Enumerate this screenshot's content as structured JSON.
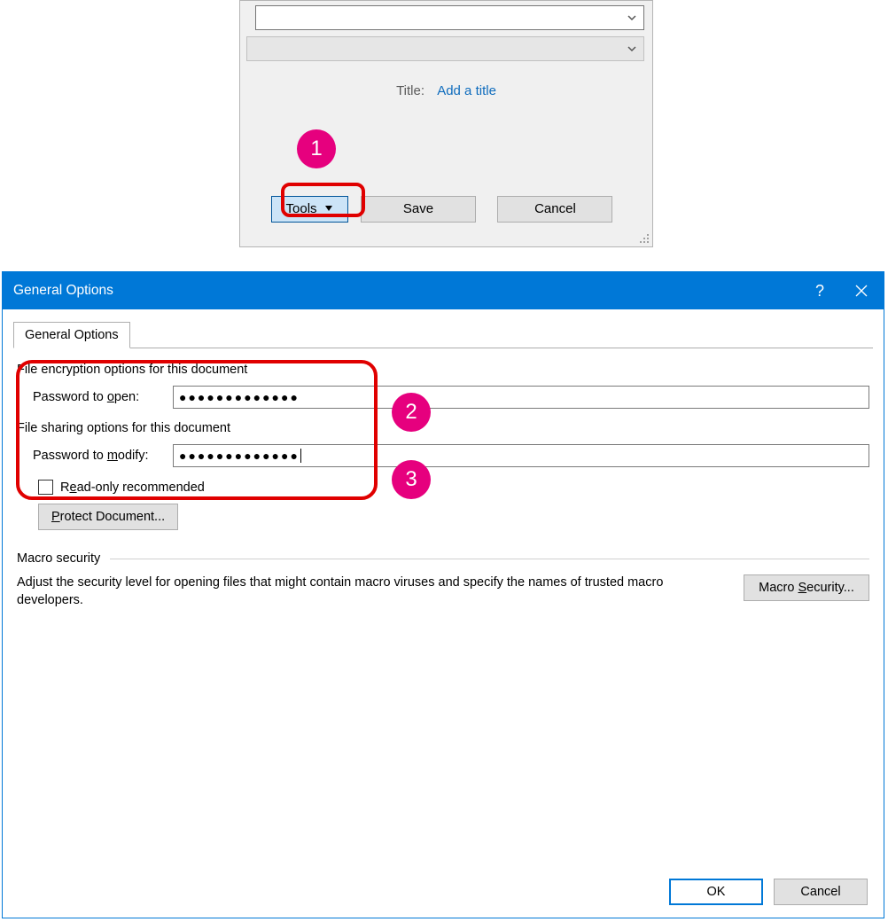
{
  "save_dialog": {
    "filename_value": "",
    "filetype_value": "",
    "title_label": "Title:",
    "title_placeholder": "Add a title",
    "tools_label": "Tools",
    "save_label": "Save",
    "cancel_label": "Cancel"
  },
  "general_options": {
    "window_title": "General Options",
    "tab_label": "General Options",
    "encryption_header": "File encryption options for this document",
    "pw_open_label_pre": "Password to ",
    "pw_open_label_u": "o",
    "pw_open_label_post": "pen:",
    "pw_open_value": "●●●●●●●●●●●●●",
    "sharing_header": "File sharing options for this document",
    "pw_modify_label_pre": "Password to ",
    "pw_modify_label_u": "m",
    "pw_modify_label_post": "odify:",
    "pw_modify_value": "●●●●●●●●●●●●●",
    "readonly_pre": "R",
    "readonly_u": "e",
    "readonly_post": "ad-only recommended",
    "protect_pre": "",
    "protect_u": "P",
    "protect_post": "rotect Document...",
    "macro_header": "Macro security",
    "macro_text": "Adjust the security level for opening files that might contain macro viruses and specify the names of trusted macro developers.",
    "macro_btn_pre": "Macro ",
    "macro_btn_u": "S",
    "macro_btn_post": "ecurity...",
    "ok_label": "OK",
    "cancel_label": "Cancel"
  },
  "callouts": {
    "c1": "1",
    "c2": "2",
    "c3": "3"
  }
}
